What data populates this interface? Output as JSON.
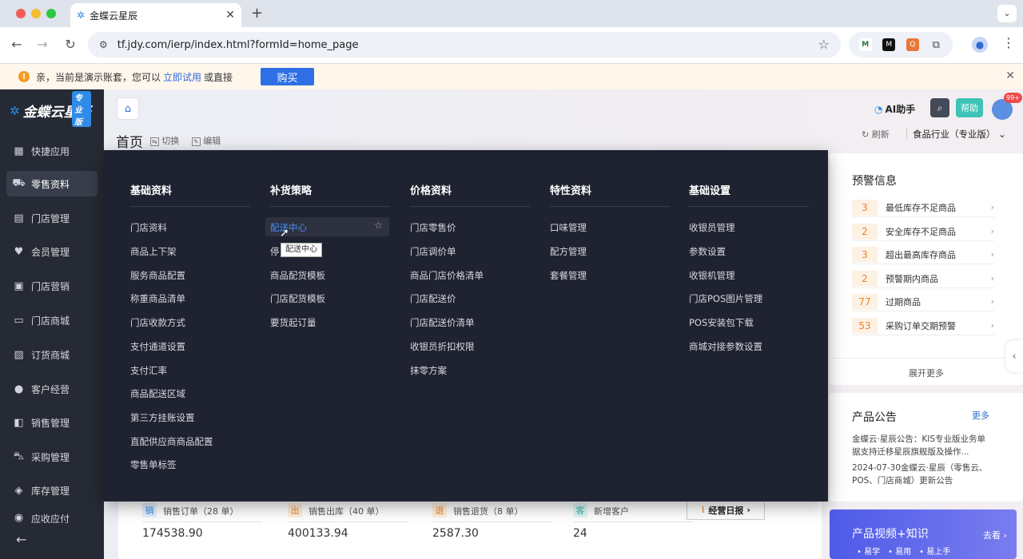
{
  "browser": {
    "tab_title": "金蝶云星辰",
    "url": "tf.jdy.com/ierp/index.html?formId=home_page",
    "extensions": [
      "M",
      "M",
      "Q"
    ]
  },
  "notice": {
    "text_before": "亲，当前是演示账套，您可以",
    "link": "立即试用",
    "text_after": "或直接",
    "buy_button": "购买"
  },
  "sidebar": {
    "logo": "金蝶云星辰",
    "badge": "专业版",
    "items": [
      {
        "label": "快捷应用",
        "icon": "grid-icon"
      },
      {
        "label": "零售资料",
        "icon": "basket-icon"
      },
      {
        "label": "门店管理",
        "icon": "store-icon"
      },
      {
        "label": "会员管理",
        "icon": "heart-icon"
      },
      {
        "label": "门店营销",
        "icon": "bag-icon"
      },
      {
        "label": "门店商城",
        "icon": "shop-icon"
      },
      {
        "label": "订货商城",
        "icon": "cart-bag-icon"
      },
      {
        "label": "客户经营",
        "icon": "user-icon"
      },
      {
        "label": "销售管理",
        "icon": "sales-icon"
      },
      {
        "label": "采购管理",
        "icon": "cart-icon"
      },
      {
        "label": "库存管理",
        "icon": "box-icon"
      },
      {
        "label": "应收应付",
        "icon": "money-icon"
      }
    ]
  },
  "header": {
    "page_title": "首页",
    "switch": "切换",
    "edit": "编辑",
    "ai": "AI助手",
    "help": "帮助",
    "notif_count": "99+",
    "refresh": "刷新",
    "industry": "食品行业（专业版）"
  },
  "menu": {
    "columns": [
      {
        "title": "基础资料",
        "items": [
          "门店资料",
          "商品上下架",
          "服务商品配置",
          "称重商品清单",
          "门店收款方式",
          "支付通道设置",
          "支付汇率",
          "商品配送区域",
          "第三方挂账设置",
          "直配供应商商品配置",
          "零售单标签"
        ]
      },
      {
        "title": "补货策略",
        "items": [
          "配送中心",
          "停",
          "商品配货模板",
          "门店配货模板",
          "要货起订量"
        ]
      },
      {
        "title": "价格资料",
        "items": [
          "门店零售价",
          "门店调价单",
          "商品门店价格清单",
          "门店配送价",
          "门店配送价清单",
          "收银员折扣权限",
          "抹零方案"
        ]
      },
      {
        "title": "特性资料",
        "items": [
          "口味管理",
          "配方管理",
          "套餐管理"
        ]
      },
      {
        "title": "基础设置",
        "items": [
          "收银员管理",
          "参数设置",
          "收银机管理",
          "门店POS图片管理",
          "POS安装包下载",
          "商城对接参数设置"
        ]
      }
    ],
    "tooltip": "配送中心"
  },
  "warnings": {
    "title": "预警信息",
    "rows": [
      {
        "num": "3",
        "label": "最低库存不足商品"
      },
      {
        "num": "2",
        "label": "安全库存不足商品"
      },
      {
        "num": "3",
        "label": "超出最高库存商品"
      },
      {
        "num": "2",
        "label": "预警期内商品"
      },
      {
        "num": "77",
        "label": "过期商品"
      },
      {
        "num": "53",
        "label": "采购订单交期预警"
      }
    ],
    "more": "展开更多"
  },
  "announcements": {
    "title": "产品公告",
    "more": "更多",
    "item1": "金蝶云·星辰公告：KIS专业版业务单据支持迁移星辰旗舰版及操作...",
    "item2": "2024-07-30金蝶云·星辰（零售云、POS、门店商城）更新公告"
  },
  "video": {
    "title": "产品视频+知识",
    "go": "去看",
    "tags": [
      "易学",
      "易用",
      "易上手"
    ]
  },
  "stats": [
    {
      "tag": "销",
      "caption": "销售订单（28 单）",
      "value": "174538.90",
      "color": "#2f8be8"
    },
    {
      "tag": "出",
      "caption": "销售出库（40 单）",
      "value": "400133.94",
      "color": "#f08a24"
    },
    {
      "tag": "退",
      "caption": "销售退货（8 单）",
      "value": "2587.30",
      "color": "#f08a24"
    },
    {
      "tag": "客",
      "caption": "新增客户",
      "value": "24",
      "color": "#2fb5a8"
    }
  ],
  "daily_report": "经营日报"
}
